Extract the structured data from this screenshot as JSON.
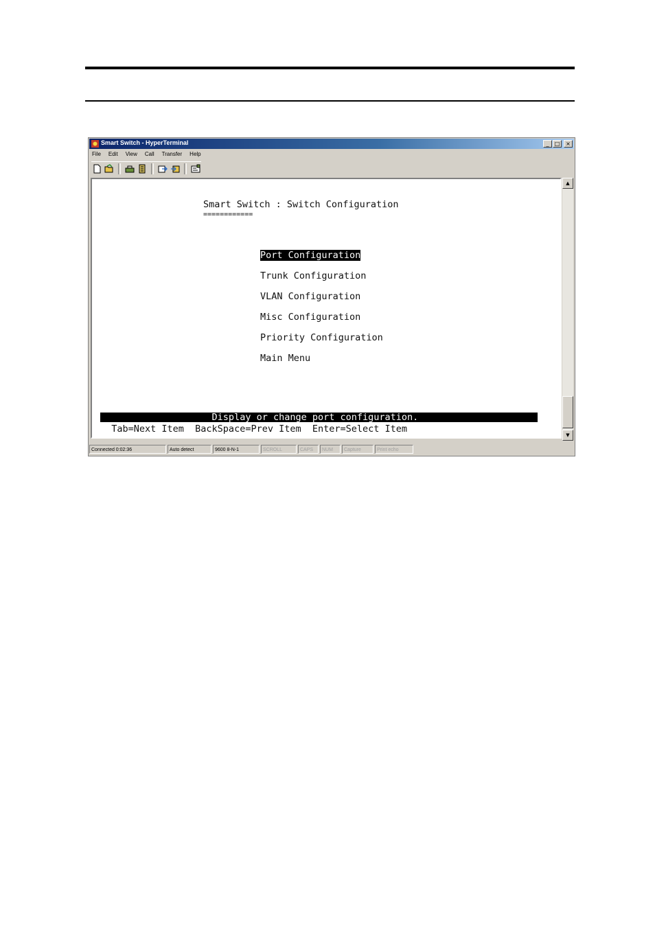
{
  "window": {
    "title": "Smart Switch - HyperTerminal",
    "buttons": {
      "minimize": "_",
      "maximize": "□",
      "close": "×"
    }
  },
  "menu": [
    "File",
    "Edit",
    "View",
    "Call",
    "Transfer",
    "Help"
  ],
  "toolbar": [
    "new-icon",
    "open-icon",
    "connect-icon",
    "disconnect-icon",
    "send-icon",
    "receive-icon",
    "properties-icon"
  ],
  "terminal": {
    "heading": "Smart Switch : Switch Configuration",
    "heading_underline": "============",
    "items": [
      "Port Configuration",
      "Trunk Configuration",
      "VLAN Configuration",
      "Misc Configuration",
      "Priority Configuration",
      "Main Menu"
    ],
    "selected_index": 0,
    "help_text": "                    Display or change port configuration.",
    "key_hints": "  Tab=Next Item  BackSpace=Prev Item  Enter=Select Item"
  },
  "scrollbar": {
    "up": "▲",
    "down": "▼"
  },
  "statusbar": {
    "connected": "Connected 0:02:36",
    "detect": "Auto detect",
    "settings": "9600 8-N-1",
    "scroll": "SCROLL",
    "caps": "CAPS",
    "num": "NUM",
    "capture": "Capture",
    "print_echo": "Print echo"
  }
}
